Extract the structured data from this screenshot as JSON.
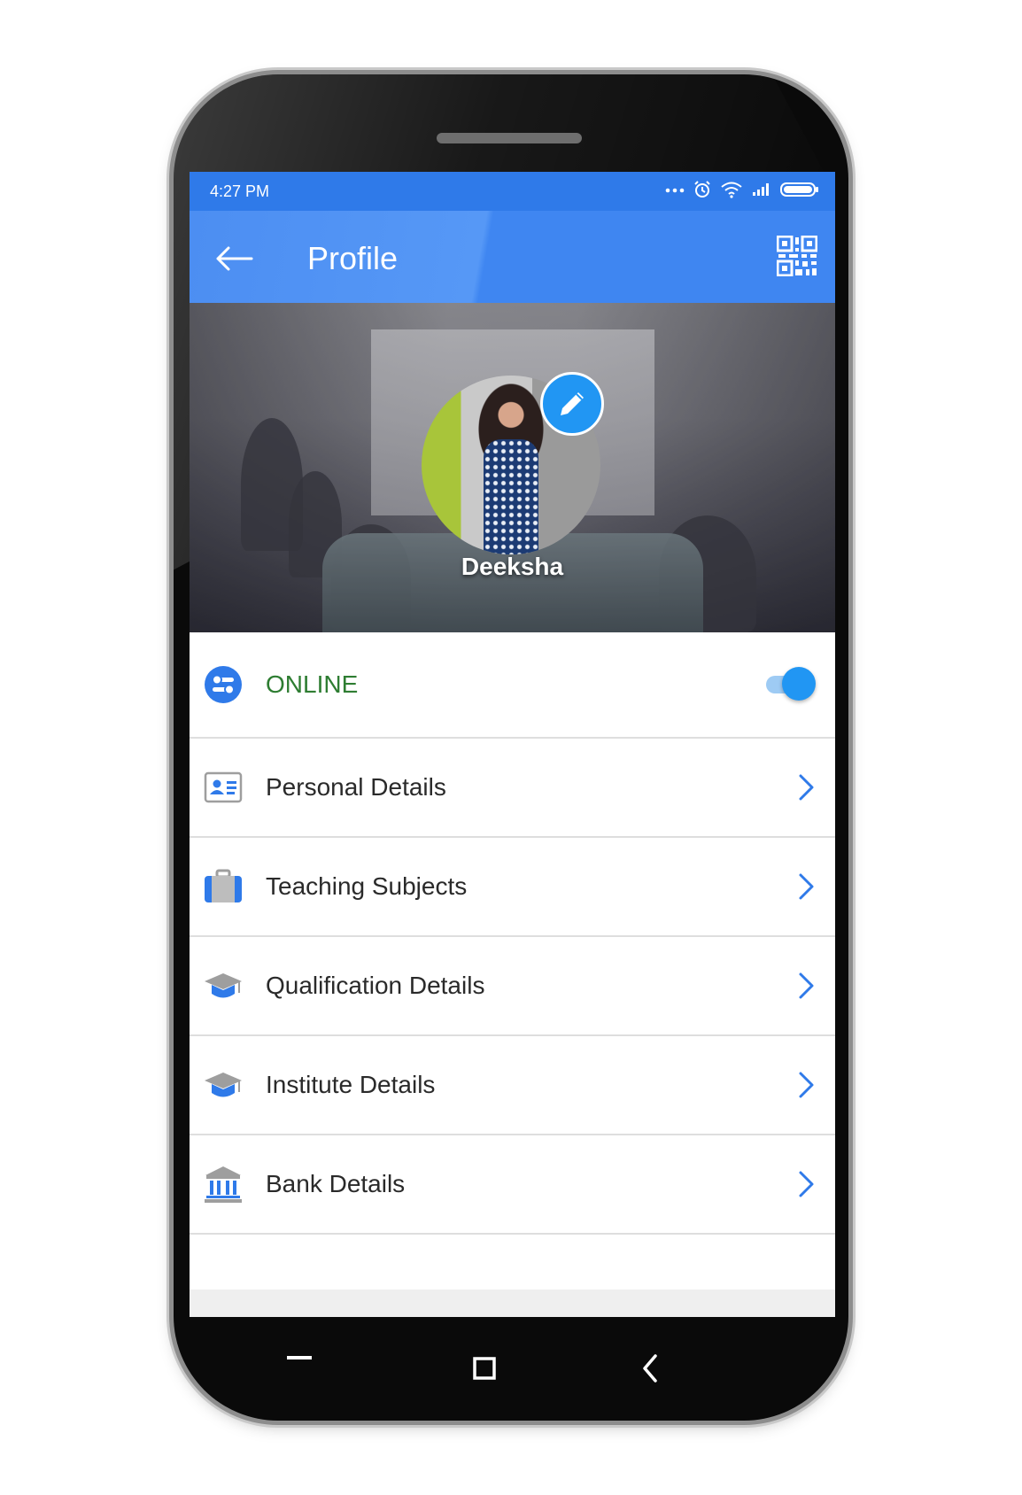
{
  "status_bar": {
    "time": "4:27 PM",
    "icons": [
      "more-dots-icon",
      "alarm-icon",
      "wifi-icon",
      "signal-icon",
      "battery-icon"
    ]
  },
  "app_bar": {
    "title": "Profile",
    "back_icon": "arrow-left-icon",
    "qr_icon": "qr-code-icon"
  },
  "profile": {
    "name": "Deeksha",
    "edit_icon": "pencil-icon"
  },
  "status_row": {
    "label": "ONLINE",
    "label_color": "#2e7d32",
    "toggle_on": true
  },
  "menu": [
    {
      "label": "Personal Details",
      "icon": "id-card-icon"
    },
    {
      "label": "Teaching Subjects",
      "icon": "briefcase-icon"
    },
    {
      "label": "Qualification Details",
      "icon": "graduation-cap-icon"
    },
    {
      "label": "Institute Details",
      "icon": "graduation-cap-icon"
    },
    {
      "label": "Bank Details",
      "icon": "bank-icon"
    }
  ],
  "colors": {
    "status_bar": "#2f7ae9",
    "app_bar": "#4c8ef2",
    "accent": "#2196f3",
    "chevron": "#2f7ae9"
  }
}
